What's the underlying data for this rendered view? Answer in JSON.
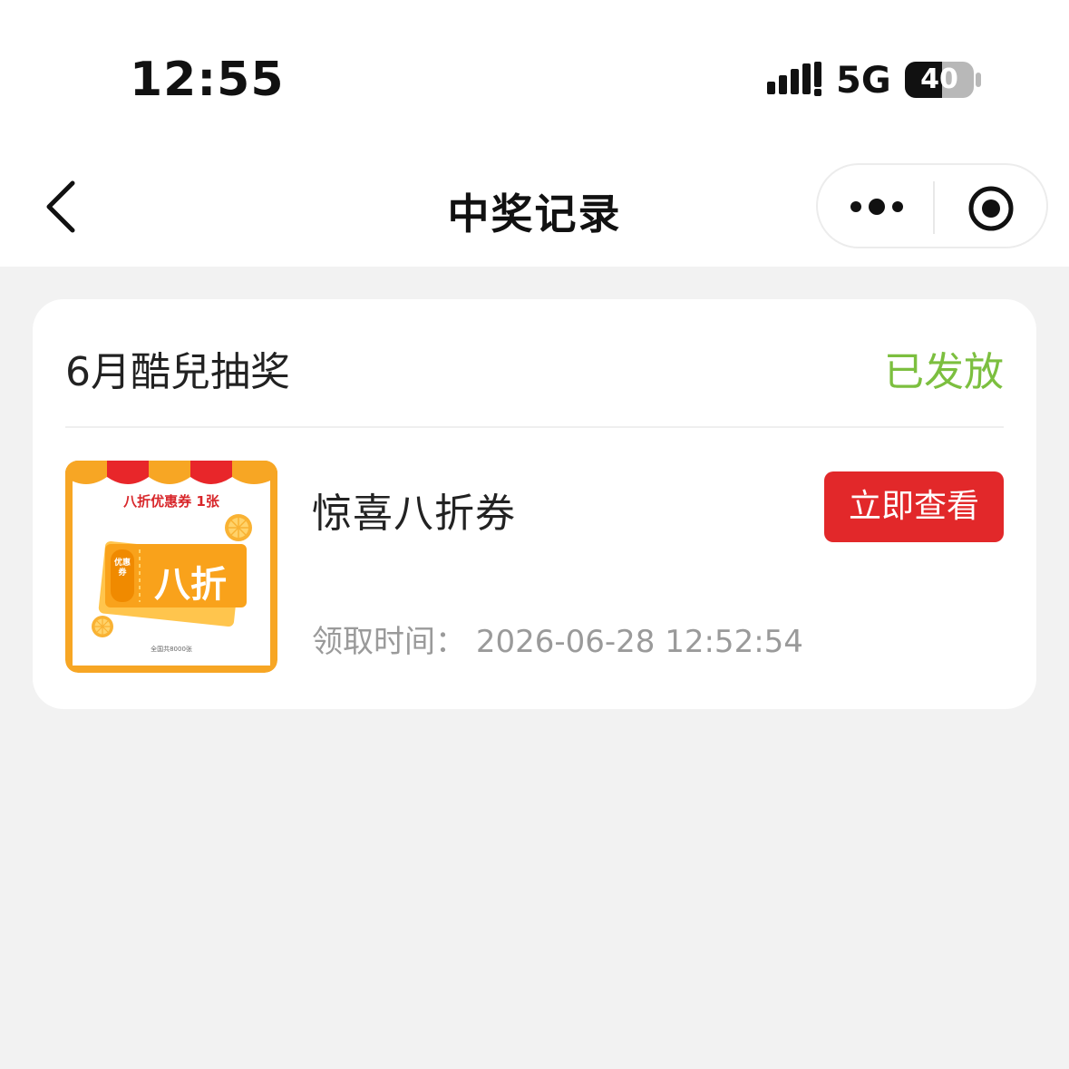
{
  "status_bar": {
    "time": "12:55",
    "network": "5G",
    "battery": "40"
  },
  "nav": {
    "title": "中奖记录"
  },
  "record": {
    "title": "6月酷兒抽奖",
    "status": "已发放",
    "status_color": "#7cbf3f",
    "thumbnail": {
      "heading": "八折优惠券 1张",
      "side_label": "优惠券",
      "main_label": "八折",
      "footer": "全国共8000张"
    },
    "prize_name": "惊喜八折券",
    "view_button": "立即查看",
    "view_button_color": "#e2282a",
    "claim_label": "领取时间：",
    "claim_time": "2026-06-28 12:52:54"
  }
}
